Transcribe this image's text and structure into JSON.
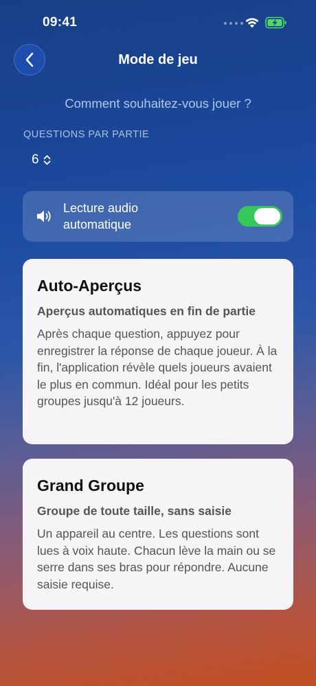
{
  "status_bar": {
    "time": "09:41"
  },
  "header": {
    "title": "Mode de jeu"
  },
  "prompt": "Comment souhaitez-vous jouer ?",
  "questions": {
    "label": "QUESTIONS PAR PARTIE",
    "value": "6"
  },
  "audio": {
    "label_line1": "Lecture audio",
    "label_line2": "automatique",
    "enabled": true
  },
  "modes": [
    {
      "title": "Auto-Aperçus",
      "subtitle": "Aperçus automatiques en fin de partie",
      "description": "Après chaque question, appuyez pour enregistrer la réponse de chaque joueur. À la fin, l'application révèle quels joueurs avaient le plus en commun. Idéal pour les petits groupes jusqu'à 12 joueurs."
    },
    {
      "title": "Grand Groupe",
      "subtitle": "Groupe de toute taille, sans saisie",
      "description": "Un appareil au centre. Les questions sont lues à voix haute. Chacun lève la main ou se serre dans ses bras pour répondre. Aucune saisie requise."
    }
  ],
  "icons": {
    "back": "chevron-left-icon",
    "picker": "chevron-up-down-icon",
    "audio": "speaker-icon",
    "wifi": "wifi-icon",
    "battery": "battery-charging-icon"
  },
  "colors": {
    "toggle_on": "#34c759",
    "battery": "#4cd964",
    "card_background": "#f6f4f6"
  }
}
